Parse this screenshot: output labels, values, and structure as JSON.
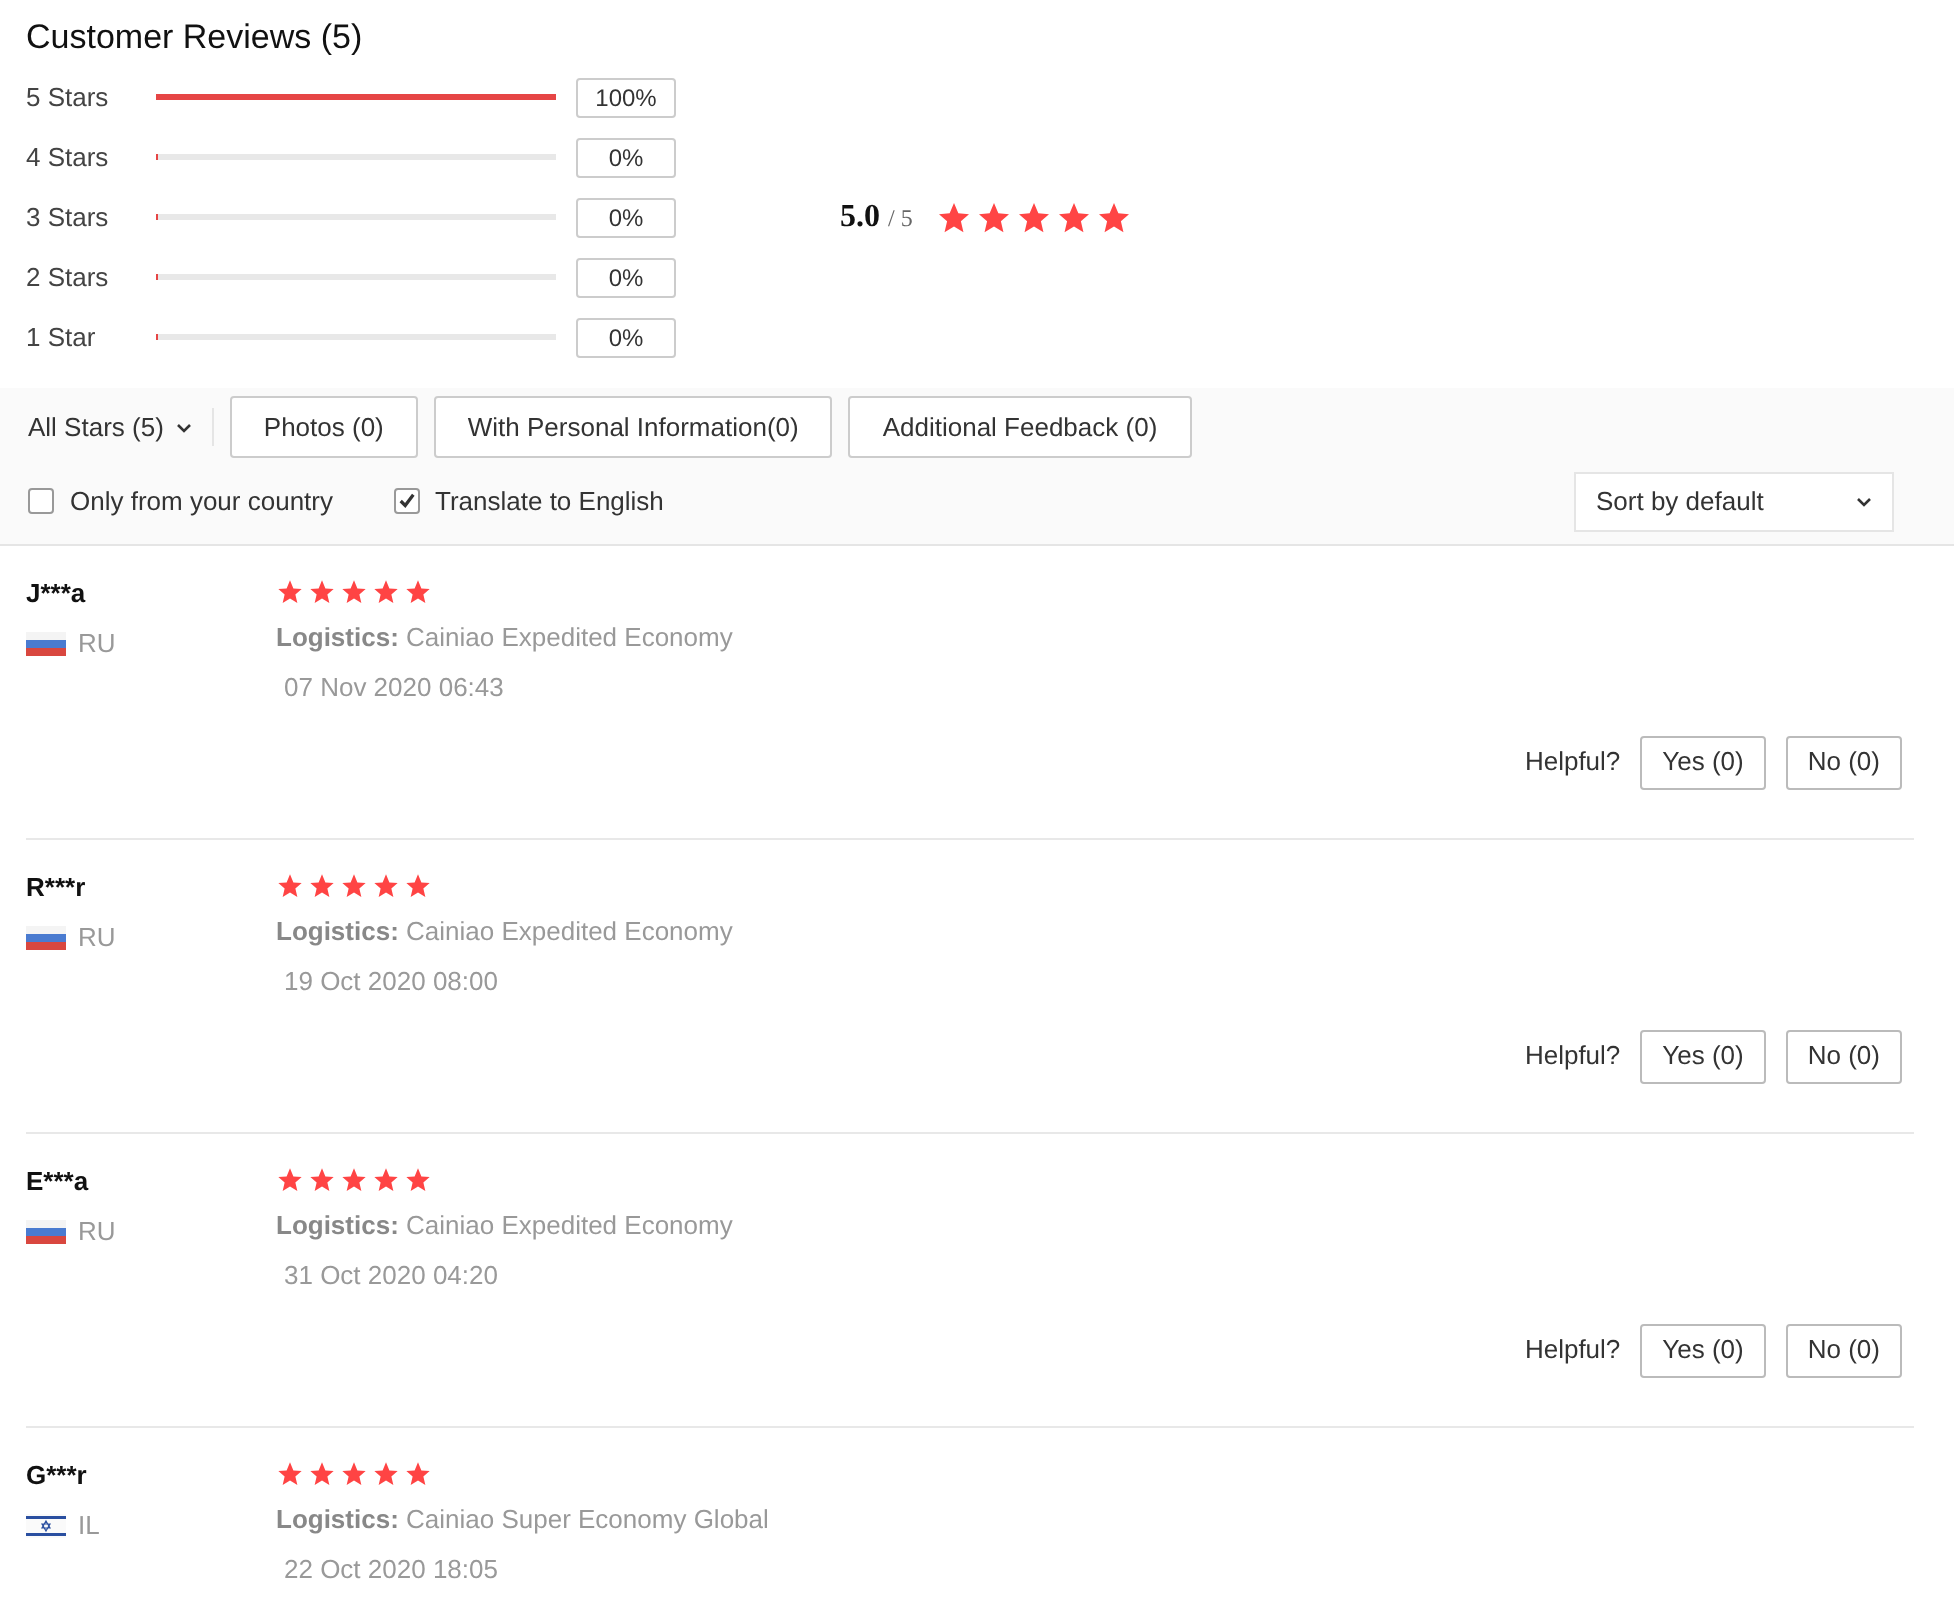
{
  "title": "Customer Reviews (5)",
  "distribution": [
    {
      "label": "5 Stars",
      "level": 1,
      "percent": "100%"
    },
    {
      "label": "4 Stars",
      "level": 0,
      "percent": "0%"
    },
    {
      "label": "3 Stars",
      "level": 0,
      "percent": "0%"
    },
    {
      "label": "2 Stars",
      "level": 0,
      "percent": "0%"
    },
    {
      "label": "1 Star",
      "level": 0,
      "percent": "0%"
    }
  ],
  "summary": {
    "rating": "5.0",
    "out_of": "/ 5",
    "stars": 5
  },
  "filters": {
    "dropdown": "All Stars (5)",
    "buttons": [
      "Photos (0)",
      "With Personal Information(0)",
      "Additional Feedback (0)"
    ]
  },
  "options": [
    {
      "label": "Only from your country",
      "checked": false
    },
    {
      "label": "Translate to English",
      "checked": true
    }
  ],
  "sort": {
    "value": "Sort by default"
  },
  "reviews": [
    {
      "name": "J***a",
      "kind": "ru",
      "country": "RU",
      "stars": 5,
      "logistics": "**Logistics:** Cainiao Expedited Economy",
      "date": "07 Nov 2020 06:43",
      "helpful": {
        "label": "Helpful?",
        "yes": "Yes (0)",
        "no": "No (0)"
      }
    },
    {
      "name": "R***r",
      "kind": "ru",
      "country": "RU",
      "stars": 5,
      "logistics": "**Logistics:** Cainiao Expedited Economy",
      "date": "19 Oct 2020 08:00",
      "helpful": {
        "label": "Helpful?",
        "yes": "Yes (0)",
        "no": "No (0)"
      }
    },
    {
      "name": "E***a",
      "kind": "ru",
      "country": "RU",
      "stars": 5,
      "logistics": "**Logistics:** Cainiao Expedited Economy",
      "date": "31 Oct 2020 04:20",
      "helpful": {
        "label": "Helpful?",
        "yes": "Yes (0)",
        "no": "No (0)"
      }
    },
    {
      "name": "G***r",
      "kind": "il",
      "country": "IL",
      "stars": 5,
      "logistics": "**Logistics:** Cainiao Super Economy Global",
      "date": "22 Oct 2020 18:05"
    }
  ]
}
